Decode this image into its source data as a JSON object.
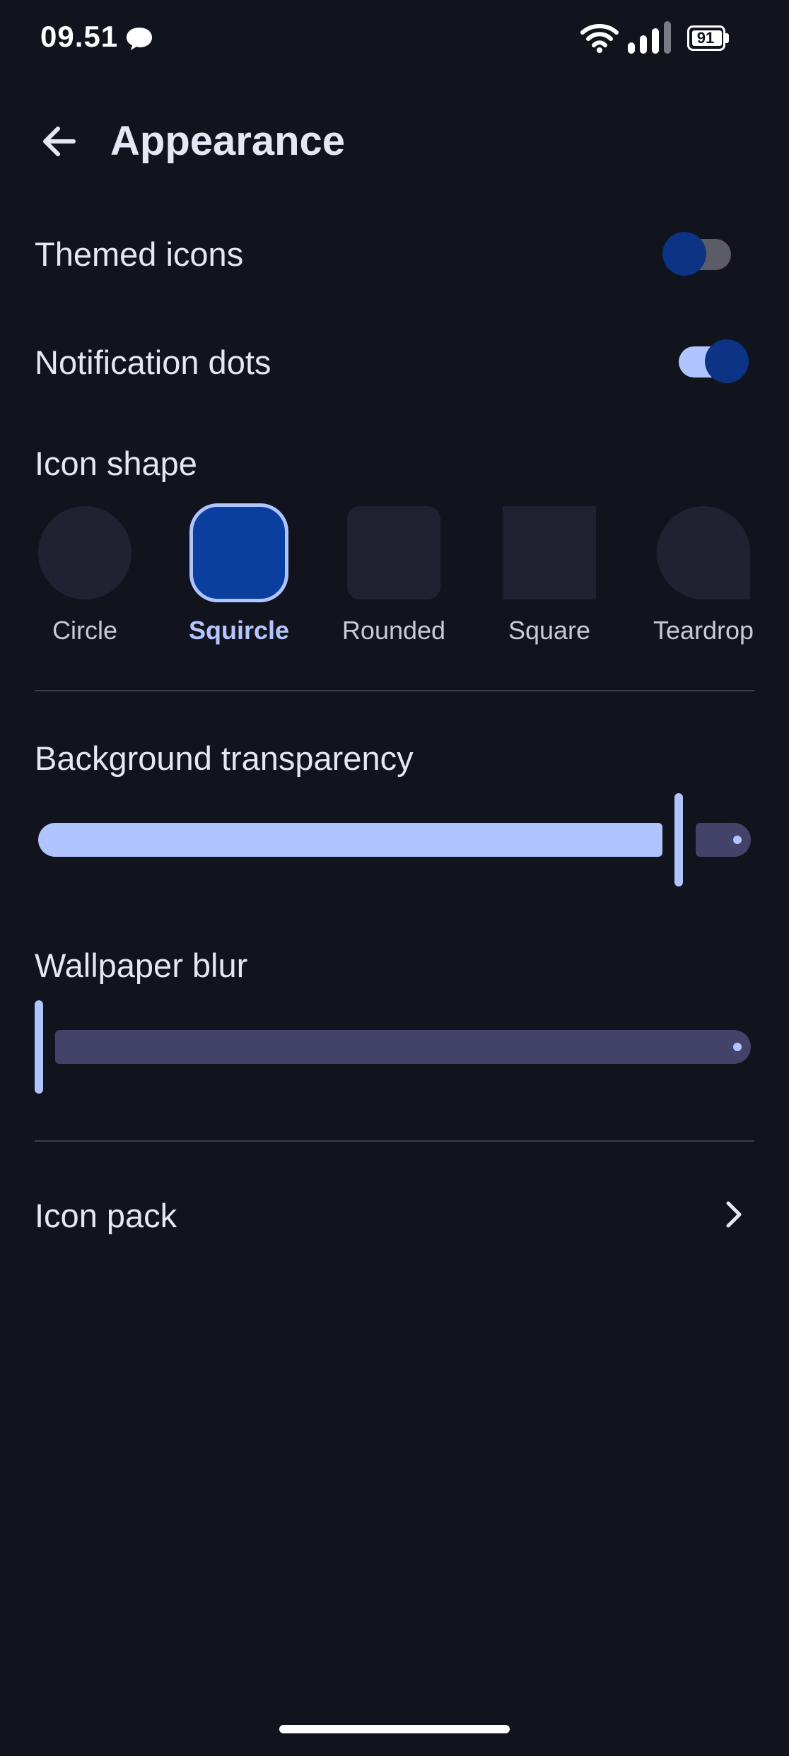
{
  "status_bar": {
    "time": "09.51",
    "battery_level": "91",
    "chat_icon": "chat-bubble-icon",
    "wifi_icon": "wifi-icon",
    "signal_icon": "signal-icon",
    "battery_icon": "battery-icon"
  },
  "header": {
    "title": "Appearance",
    "back_icon": "arrow-left-icon"
  },
  "settings": {
    "themed_icons": {
      "label": "Themed icons",
      "enabled": false
    },
    "notification_dots": {
      "label": "Notification dots",
      "enabled": true
    }
  },
  "icon_shape": {
    "label": "Icon shape",
    "selected": "Squircle",
    "options": [
      {
        "label": "Circle"
      },
      {
        "label": "Squircle"
      },
      {
        "label": "Rounded"
      },
      {
        "label": "Square"
      },
      {
        "label": "Teardrop"
      }
    ]
  },
  "background_transparency": {
    "label": "Background transparency",
    "value_fraction": 0.9
  },
  "wallpaper_blur": {
    "label": "Wallpaper blur",
    "value_fraction": 0.0
  },
  "icon_pack": {
    "label": "Icon pack",
    "chevron_icon": "chevron-right-icon"
  },
  "colors": {
    "background": "#11131d",
    "accent": "#b0c4ff",
    "thumb": "#0c3384",
    "selected_shape_fill": "#0a3fa0",
    "shape_fill": "#202231",
    "slider_inactive": "#43436a"
  }
}
